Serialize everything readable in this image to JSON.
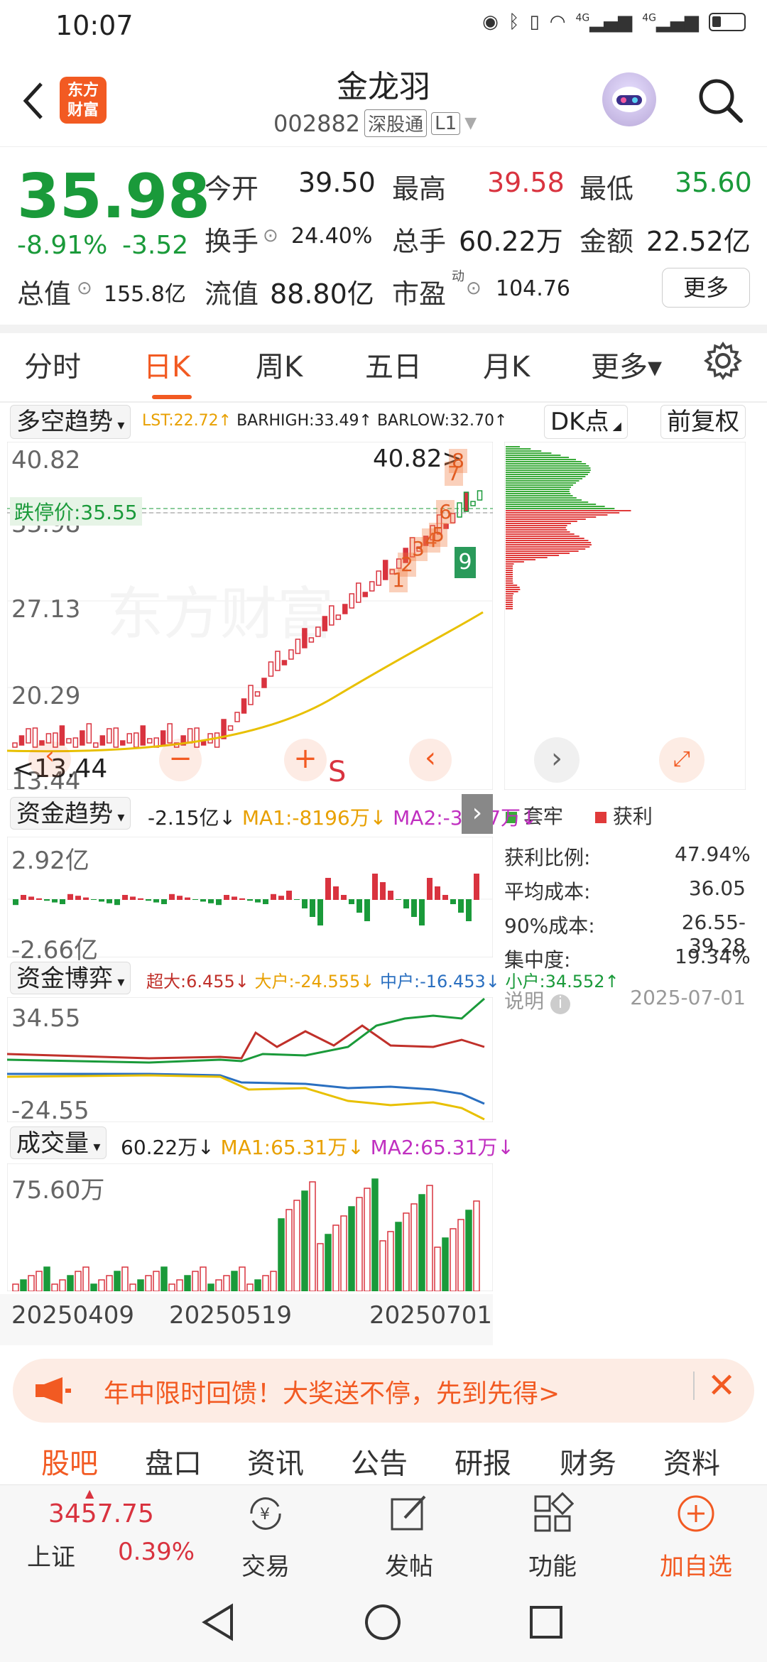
{
  "status": {
    "time": "10:07",
    "net1": "4G",
    "net2": "4G"
  },
  "header": {
    "title": "金龙羽",
    "code": "002882",
    "market_tag": "深股通",
    "level_tag": "L1",
    "logo": "东方\n财富"
  },
  "quote": {
    "price": "35.98",
    "change_pct": "-8.91%",
    "change": "-3.52",
    "items": [
      {
        "label": "今开",
        "value": "39.50",
        "color": "#222"
      },
      {
        "label": "最高",
        "value": "39.58",
        "color": "#d9333f"
      },
      {
        "label": "最低",
        "value": "35.60",
        "color": "#1a9a3a"
      },
      {
        "label": "换手",
        "value": "24.40%",
        "color": "#222"
      },
      {
        "label": "总手",
        "value": "60.22万",
        "color": "#222"
      },
      {
        "label": "金额",
        "value": "22.52亿",
        "color": "#222"
      },
      {
        "label": "总值",
        "value": "155.8亿",
        "color": "#222"
      },
      {
        "label": "流值",
        "value": "88.80亿",
        "color": "#222"
      },
      {
        "label": "市盈",
        "value": "104.76",
        "color": "#222"
      }
    ],
    "pe_sup": "动",
    "more": "更多"
  },
  "tabs": [
    {
      "label": "分时"
    },
    {
      "label": "日K"
    },
    {
      "label": "周K"
    },
    {
      "label": "五日"
    },
    {
      "label": "月K"
    },
    {
      "label": "更多▾"
    }
  ],
  "kline": {
    "indicator": "多空趋势",
    "legend": [
      {
        "text": "LST:22.72↑",
        "color": "#e8a000"
      },
      {
        "text": "BARHIGH:33.49↑",
        "color": "#222"
      },
      {
        "text": "BARLOW:32.70↑",
        "color": "#222"
      }
    ],
    "dk_btn": "DK点",
    "adjust_btn": "前复权",
    "y_labels": [
      "40.82",
      "33.98",
      "27.13",
      "20.29",
      "13.44"
    ],
    "high_mark": "40.82>",
    "low_mark": "<13.44",
    "limit_down": "跌停价:35.55",
    "watermark": "东方财富",
    "signal_s": "S",
    "seq_labels": [
      "1",
      "2",
      "3",
      "4",
      "5",
      "6",
      "7",
      "8",
      "9"
    ]
  },
  "chip": {
    "legend_trap": "套牢",
    "legend_profit": "获利",
    "rows": [
      {
        "label": "获利比例:",
        "value": "47.94%"
      },
      {
        "label": "平均成本:",
        "value": "36.05"
      },
      {
        "label": "90%成本:",
        "value": "26.55-39.28"
      },
      {
        "label": "集中度:",
        "value": "19.34%"
      }
    ],
    "note": "说明",
    "date": "2025-07-01"
  },
  "fund_trend": {
    "indicator": "资金趋势",
    "legend": [
      {
        "text": "-2.15亿↓",
        "color": "#222"
      },
      {
        "text": "MA1:-8196万↓",
        "color": "#e8a000"
      },
      {
        "text": "MA2:-3227万↓",
        "color": "#c030c0"
      }
    ],
    "y_top": "2.92亿",
    "y_bottom": "-2.66亿"
  },
  "fund_game": {
    "indicator": "资金博弈",
    "legend": [
      {
        "text": "超大:6.455↓",
        "color": "#c0302a"
      },
      {
        "text": "大户:-24.555↓",
        "color": "#e8a000"
      },
      {
        "text": "中户:-16.453↓",
        "color": "#2a6fc0"
      },
      {
        "text": "小户:34.552↑",
        "color": "#1a9a3a"
      }
    ],
    "y_top": "34.55",
    "y_bottom": "-24.55"
  },
  "volume": {
    "indicator": "成交量",
    "legend": [
      {
        "text": "60.22万↓",
        "color": "#222"
      },
      {
        "text": "MA1:65.31万↓",
        "color": "#e8a000"
      },
      {
        "text": "MA2:65.31万↓",
        "color": "#c030c0"
      }
    ],
    "y_top": "75.60万",
    "dates": [
      "20250409",
      "20250519",
      "20250701"
    ]
  },
  "promo": {
    "text": "年中限时回馈！大奖送不停，先到先得>"
  },
  "bottom_tabs": [
    "股吧",
    "盘口",
    "资讯",
    "公告",
    "研报",
    "财务",
    "资料"
  ],
  "dock": {
    "index_value": "3457.75",
    "index_name": "上证",
    "index_pct": "0.39%",
    "items": [
      {
        "label": "交易"
      },
      {
        "label": "发帖"
      },
      {
        "label": "功能"
      },
      {
        "label": "加自选"
      }
    ]
  }
}
